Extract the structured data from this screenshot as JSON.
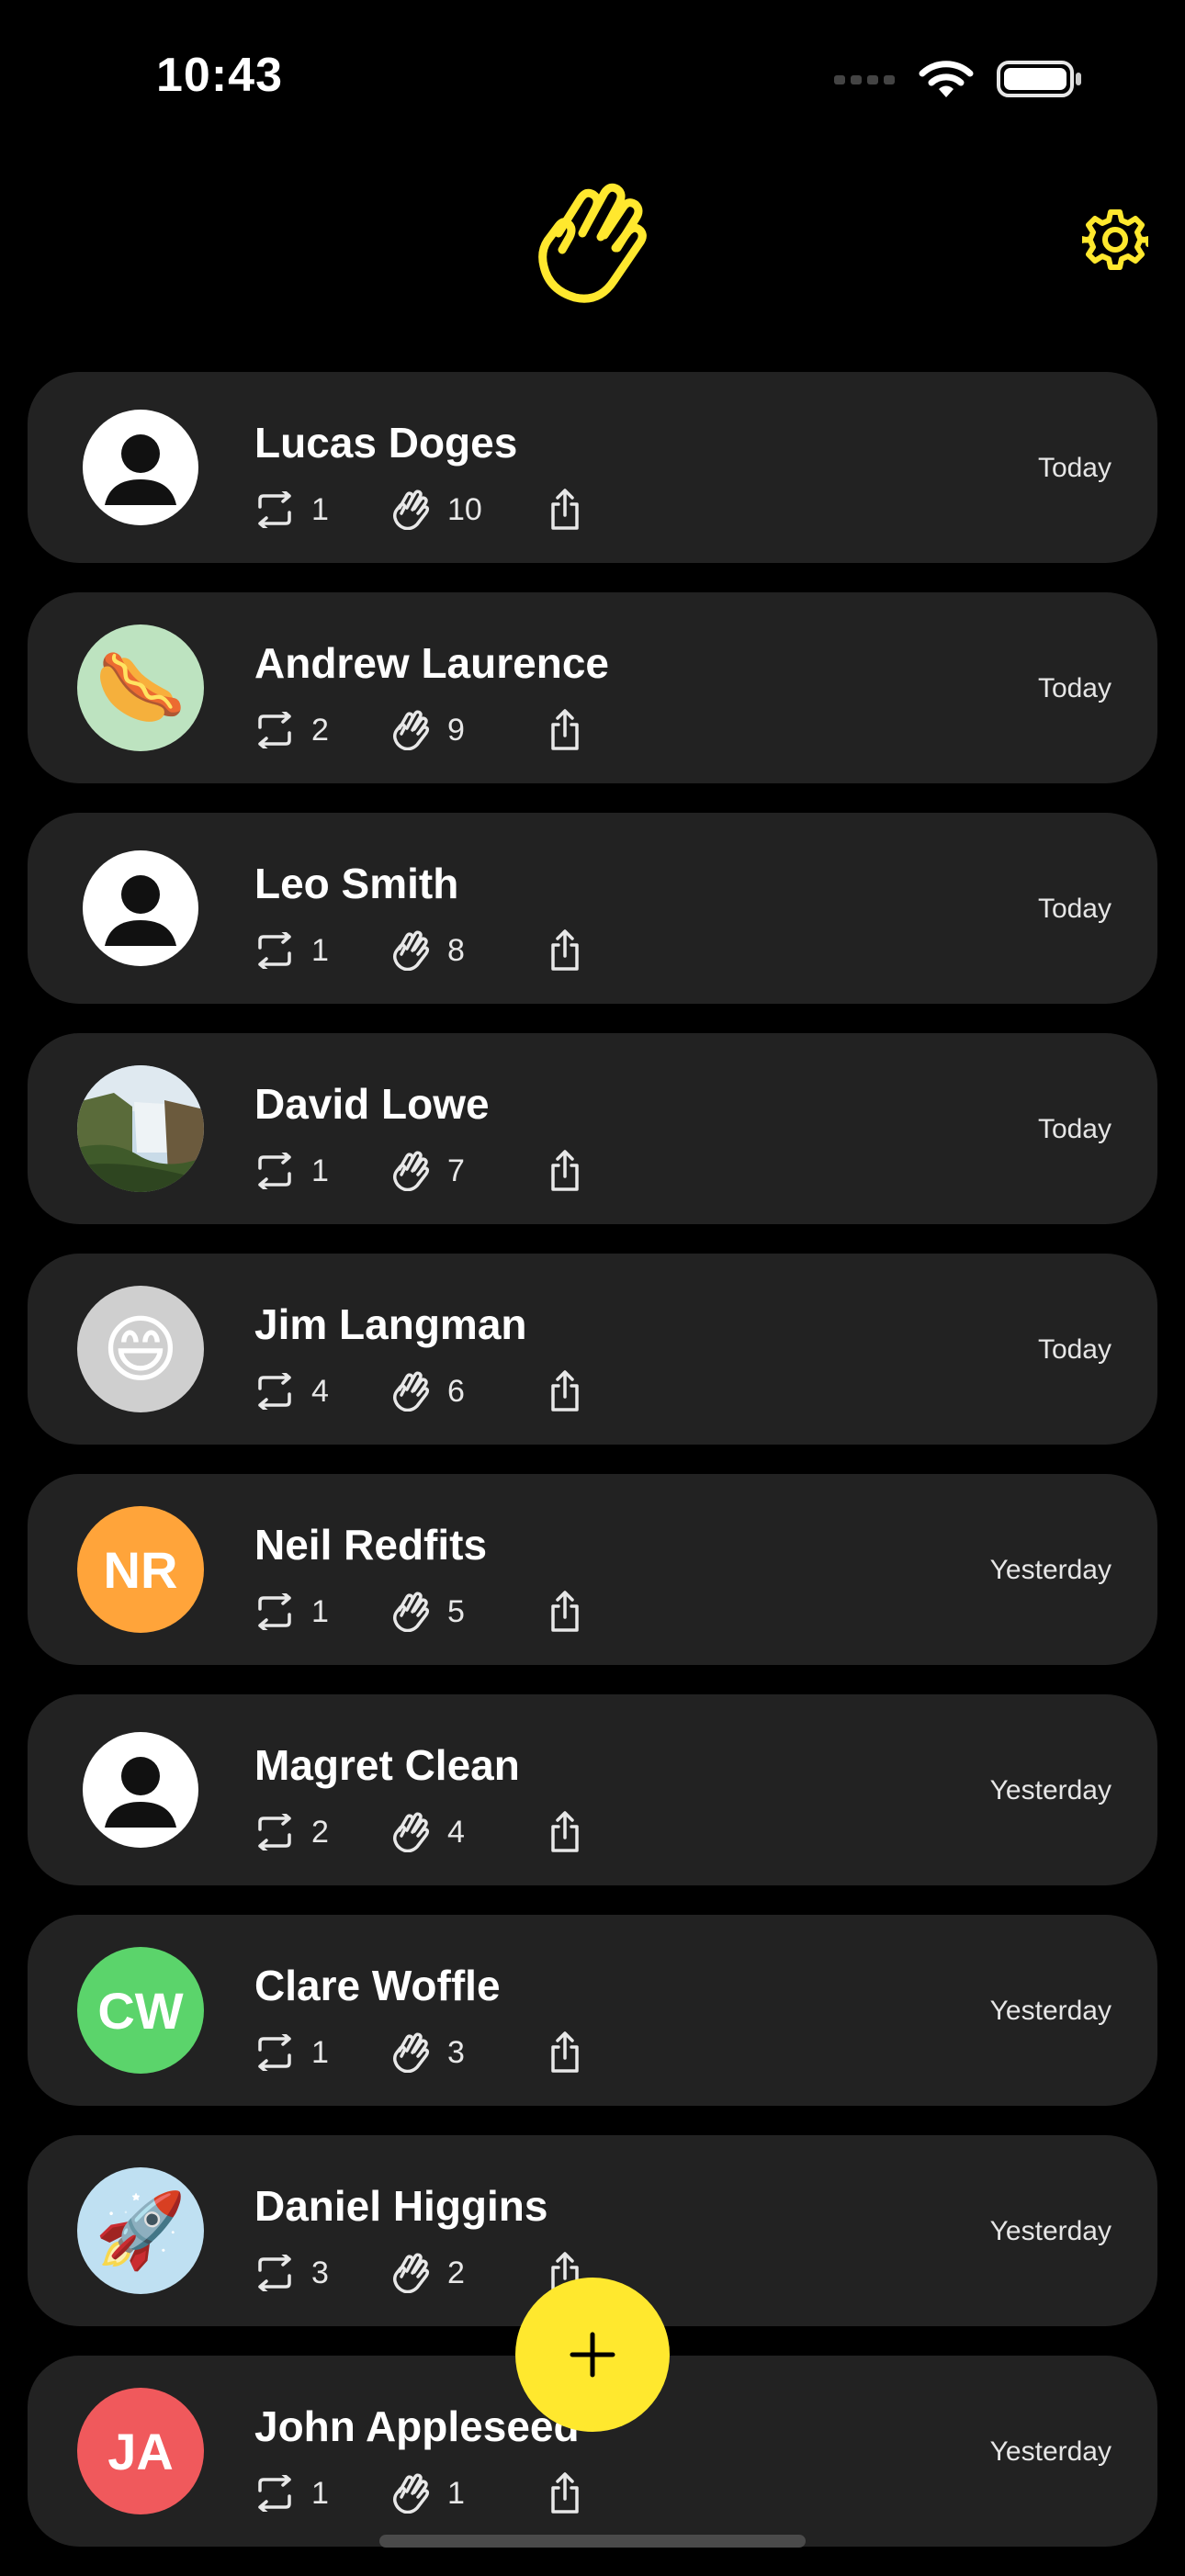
{
  "status_bar": {
    "time": "10:43"
  },
  "colors": {
    "accent": "#FFE82E",
    "card": "#222222",
    "background": "#000000"
  },
  "header": {
    "logo_icon": "waving-hand-icon",
    "settings_icon": "gear-icon"
  },
  "contacts": [
    {
      "name": "Lucas Doges",
      "avatar": {
        "kind": "placeholder"
      },
      "reposts": "1",
      "waves": "10",
      "date": "Today"
    },
    {
      "name": "Andrew Laurence",
      "avatar": {
        "kind": "emoji",
        "value": "🌭",
        "bg": "#BDE3C0"
      },
      "reposts": "2",
      "waves": "9",
      "date": "Today"
    },
    {
      "name": "Leo Smith",
      "avatar": {
        "kind": "placeholder"
      },
      "reposts": "1",
      "waves": "8",
      "date": "Today"
    },
    {
      "name": "David Lowe",
      "avatar": {
        "kind": "photo"
      },
      "reposts": "1",
      "waves": "7",
      "date": "Today"
    },
    {
      "name": "Jim Langman",
      "avatar": {
        "kind": "emoji",
        "value": "😄",
        "bg": "#CFCFCF"
      },
      "reposts": "4",
      "waves": "6",
      "date": "Today"
    },
    {
      "name": "Neil Redfits",
      "avatar": {
        "kind": "initials",
        "value": "NR",
        "bg": "#FFA43A"
      },
      "reposts": "1",
      "waves": "5",
      "date": "Yesterday"
    },
    {
      "name": "Magret Clean",
      "avatar": {
        "kind": "placeholder"
      },
      "reposts": "2",
      "waves": "4",
      "date": "Yesterday"
    },
    {
      "name": "Clare Woffle",
      "avatar": {
        "kind": "initials",
        "value": "CW",
        "bg": "#5BD46B"
      },
      "reposts": "1",
      "waves": "3",
      "date": "Yesterday"
    },
    {
      "name": "Daniel Higgins",
      "avatar": {
        "kind": "emoji",
        "value": "🚀",
        "bg": "#BFE0F2"
      },
      "reposts": "3",
      "waves": "2",
      "date": "Yesterday"
    },
    {
      "name": "John Appleseed",
      "avatar": {
        "kind": "initials",
        "value": "JA",
        "bg": "#F0595C"
      },
      "reposts": "1",
      "waves": "1",
      "date": "Yesterday"
    }
  ],
  "fab": {
    "icon": "plus-icon"
  }
}
